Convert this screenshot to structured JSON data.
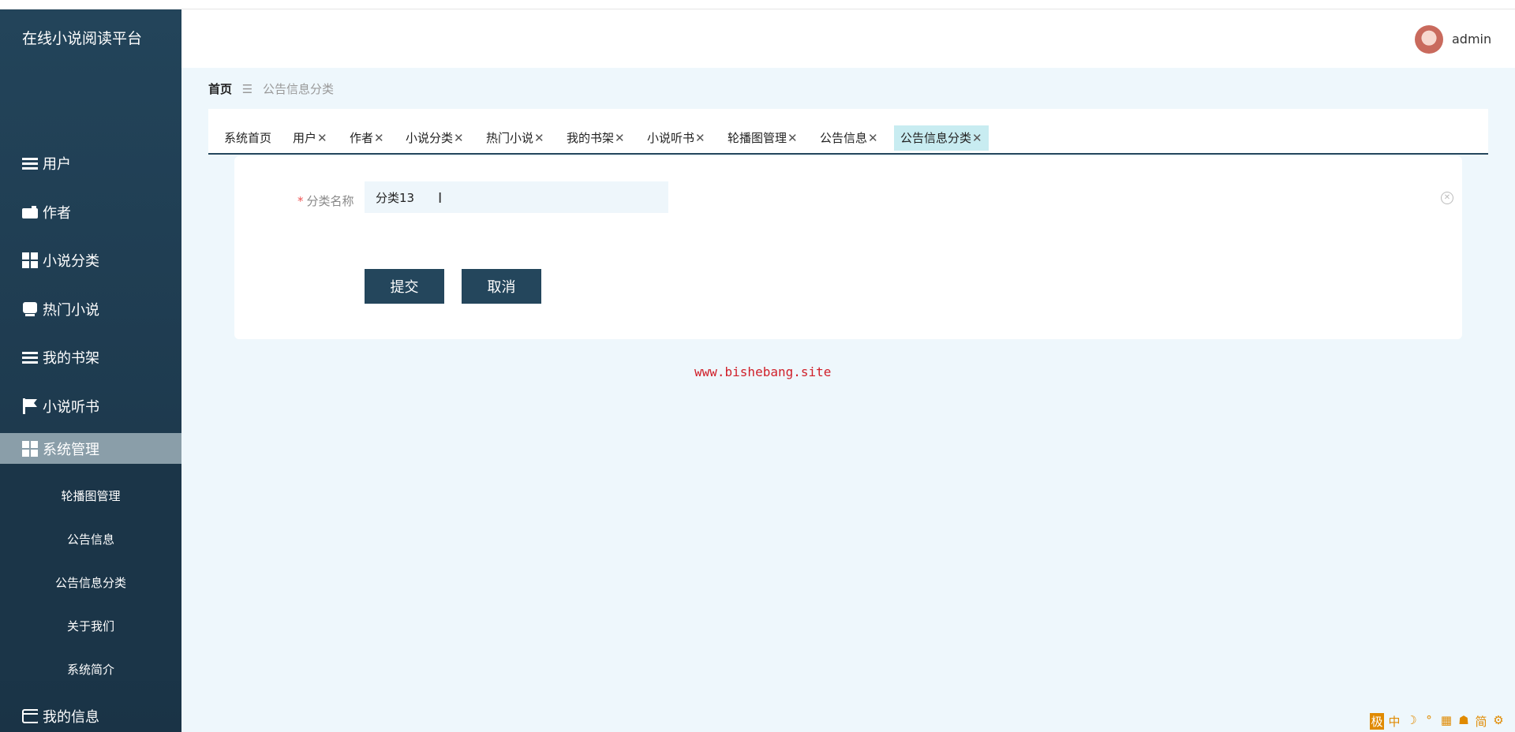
{
  "app": {
    "title": "在线小说阅读平台"
  },
  "header": {
    "username": "admin"
  },
  "sidebar": {
    "items": [
      {
        "label": "用户",
        "icon": "list-icon"
      },
      {
        "label": "作者",
        "icon": "wallet-icon"
      },
      {
        "label": "小说分类",
        "icon": "grid-icon"
      },
      {
        "label": "热门小说",
        "icon": "inbox-icon"
      },
      {
        "label": "我的书架",
        "icon": "list-icon"
      },
      {
        "label": "小说听书",
        "icon": "flag-icon"
      },
      {
        "label": "系统管理",
        "icon": "grid-icon",
        "active": true
      },
      {
        "label": "我的信息",
        "icon": "card-icon"
      }
    ],
    "submenu": [
      "轮播图管理",
      "公告信息",
      "公告信息分类",
      "关于我们",
      "系统简介"
    ]
  },
  "breadcrumb": {
    "home": "首页",
    "separator": "☰",
    "current": "公告信息分类"
  },
  "tabs": [
    {
      "label": "系统首页",
      "closable": false
    },
    {
      "label": "用户",
      "closable": true
    },
    {
      "label": "作者",
      "closable": true
    },
    {
      "label": "小说分类",
      "closable": true
    },
    {
      "label": "热门小说",
      "closable": true
    },
    {
      "label": "我的书架",
      "closable": true
    },
    {
      "label": "小说听书",
      "closable": true
    },
    {
      "label": "轮播图管理",
      "closable": true
    },
    {
      "label": "公告信息",
      "closable": true
    },
    {
      "label": "公告信息分类",
      "closable": true,
      "active": true
    }
  ],
  "form": {
    "field_label": "分类名称",
    "required_mark": "*",
    "field_value": "分类13",
    "submit_label": "提交",
    "cancel_label": "取消"
  },
  "watermark": "www.bishebang.site",
  "ime_toolbar": [
    "极",
    "中",
    "☽",
    "°",
    "▦",
    "☗",
    "简",
    "⚙"
  ],
  "colors": {
    "primary": "#24465c",
    "active_tab": "#c8ecf1",
    "watermark": "#d0202a"
  }
}
